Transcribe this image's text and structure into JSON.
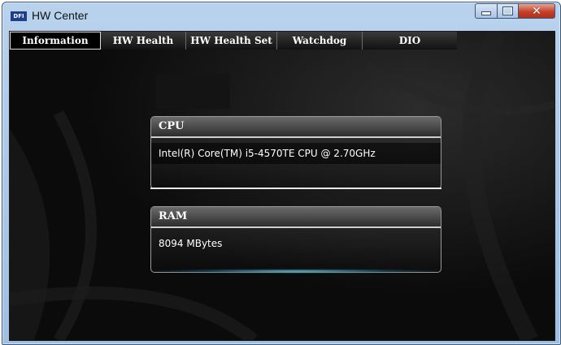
{
  "window": {
    "title": "HW Center",
    "logo_text": "DFI"
  },
  "tabs": [
    {
      "label": "Information",
      "active": true
    },
    {
      "label": "HW Health",
      "active": false
    },
    {
      "label": "HW Health Set",
      "active": false
    },
    {
      "label": "Watchdog",
      "active": false
    },
    {
      "label": "DIO",
      "active": false
    }
  ],
  "cpu": {
    "title": "CPU",
    "value": "Intel(R) Core(TM) i5-4570TE CPU @ 2.70GHz"
  },
  "ram": {
    "title": "RAM",
    "value": "8094 MBytes"
  },
  "colors": {
    "background": "#0b0b0b",
    "accent_glow": "#78d2e6",
    "close_button": "#c3412a"
  },
  "icons": [
    "dfi-logo-icon",
    "minimize-icon",
    "maximize-icon",
    "close-icon"
  ]
}
